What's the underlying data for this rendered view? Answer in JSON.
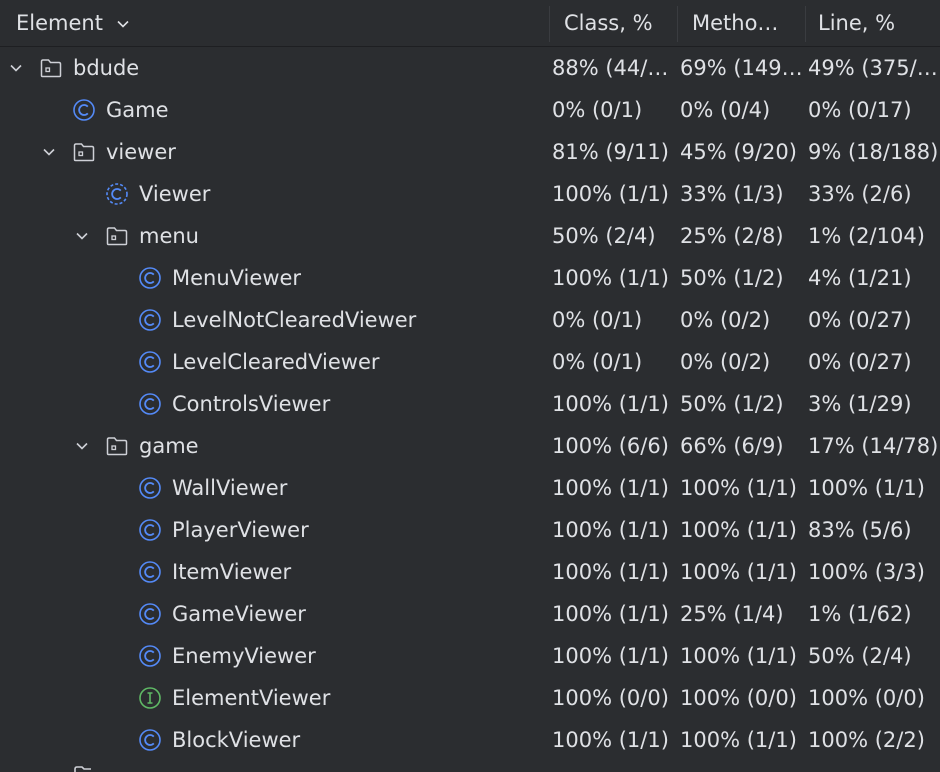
{
  "columns": {
    "element": "Element",
    "class": "Class, %",
    "method": "Metho…",
    "line": "Line, %"
  },
  "colors": {
    "background": "#2b2d30",
    "text": "#dfe1e5",
    "class_icon": "#548af7",
    "interface_icon": "#5fb865",
    "folder_icon": "#ced0d6"
  },
  "rows": [
    {
      "name": "bdude",
      "kind": "folder",
      "expanded": true,
      "class": "88% (44/…",
      "method": "69% (149…",
      "line": "49% (375/…"
    },
    {
      "name": "Game",
      "kind": "class",
      "class": "0% (0/1)",
      "method": "0% (0/4)",
      "line": "0% (0/17)"
    },
    {
      "name": "viewer",
      "kind": "folder",
      "expanded": true,
      "class": "81% (9/11)",
      "method": "45% (9/20)",
      "line": "9% (18/188)"
    },
    {
      "name": "Viewer",
      "kind": "abstract-class",
      "class": "100% (1/1)",
      "method": "33% (1/3)",
      "line": "33% (2/6)"
    },
    {
      "name": "menu",
      "kind": "folder",
      "expanded": true,
      "class": "50% (2/4)",
      "method": "25% (2/8)",
      "line": "1% (2/104)"
    },
    {
      "name": "MenuViewer",
      "kind": "class",
      "class": "100% (1/1)",
      "method": "50% (1/2)",
      "line": "4% (1/21)"
    },
    {
      "name": "LevelNotClearedViewer",
      "kind": "class",
      "class": "0% (0/1)",
      "method": "0% (0/2)",
      "line": "0% (0/27)"
    },
    {
      "name": "LevelClearedViewer",
      "kind": "class",
      "class": "0% (0/1)",
      "method": "0% (0/2)",
      "line": "0% (0/27)"
    },
    {
      "name": "ControlsViewer",
      "kind": "class",
      "class": "100% (1/1)",
      "method": "50% (1/2)",
      "line": "3% (1/29)"
    },
    {
      "name": "game",
      "kind": "folder",
      "expanded": true,
      "class": "100% (6/6)",
      "method": "66% (6/9)",
      "line": "17% (14/78)"
    },
    {
      "name": "WallViewer",
      "kind": "class",
      "class": "100% (1/1)",
      "method": "100% (1/1)",
      "line": "100% (1/1)"
    },
    {
      "name": "PlayerViewer",
      "kind": "class",
      "class": "100% (1/1)",
      "method": "100% (1/1)",
      "line": "83% (5/6)"
    },
    {
      "name": "ItemViewer",
      "kind": "class",
      "class": "100% (1/1)",
      "method": "100% (1/1)",
      "line": "100% (3/3)"
    },
    {
      "name": "GameViewer",
      "kind": "class",
      "class": "100% (1/1)",
      "method": "25% (1/4)",
      "line": "1% (1/62)"
    },
    {
      "name": "EnemyViewer",
      "kind": "class",
      "class": "100% (1/1)",
      "method": "100% (1/1)",
      "line": "50% (2/4)"
    },
    {
      "name": "ElementViewer",
      "kind": "interface",
      "class": "100% (0/0)",
      "method": "100% (0/0)",
      "line": "100% (0/0)"
    },
    {
      "name": "BlockViewer",
      "kind": "class",
      "class": "100% (1/1)",
      "method": "100% (1/1)",
      "line": "100% (2/2)"
    }
  ]
}
